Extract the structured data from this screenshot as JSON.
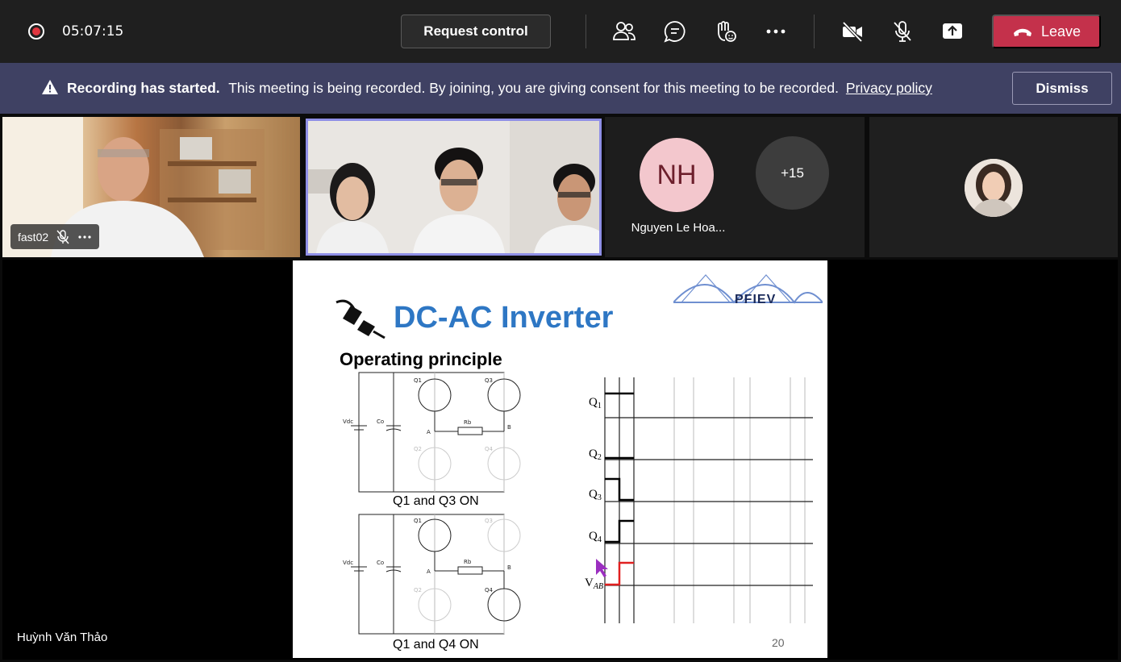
{
  "toolbar": {
    "timer": "05:07:15",
    "request_control_label": "Request control",
    "leave_label": "Leave"
  },
  "banner": {
    "title": "Recording has started.",
    "message": "This meeting is being recorded. By joining, you are giving consent for this meeting to be recorded.",
    "link": "Privacy policy",
    "dismiss_label": "Dismiss"
  },
  "participants": {
    "tile1_name": "fast02",
    "nh_initials": "NH",
    "nh_name": "Nguyen Le Hoa...",
    "more_count": "+15"
  },
  "share": {
    "presenter": "Huỳnh Văn Thảo",
    "slide_title": "DC-AC Inverter",
    "slide_subtitle": "Operating principle",
    "caption1": "Q1 and Q3 ON",
    "caption2": "Q1 and Q4 ON",
    "page_number": "20",
    "logo_text": "PFIEV",
    "circuit_labels": {
      "vdc": "Vdc",
      "co": "Co",
      "q1": "Q1",
      "q2": "Q2",
      "q3": "Q3",
      "q4": "Q4",
      "rb": "Rb",
      "a": "A",
      "b": "B"
    },
    "waveform_labels": {
      "q1": "Q",
      "q2": "Q",
      "q3": "Q",
      "q4": "Q",
      "vab": "V",
      "q1_sub": "1",
      "q2_sub": "2",
      "q3_sub": "3",
      "q4_sub": "4",
      "vab_sub": "AB"
    }
  },
  "colors": {
    "topbar": "#1f1f1f",
    "banner": "#3f4163",
    "leave": "#c4314b",
    "slide_title": "#2e77c4",
    "waveform_red": "#e02020",
    "active_speaker_border": "#8f8fe6"
  }
}
